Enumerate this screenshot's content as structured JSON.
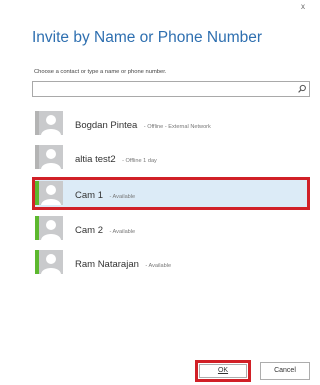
{
  "dialog": {
    "close_label": "x",
    "title": "Invite by Name or Phone Number",
    "instruction": "Choose a contact or type a name or phone number.",
    "search": {
      "value": "",
      "placeholder": "",
      "icon": "search-icon"
    },
    "contacts": [
      {
        "name": "Bogdan Pintea",
        "status": "- Offline - External Network",
        "presence": "offline",
        "selected": false
      },
      {
        "name": "altia test2",
        "status": "- Offline 1 day",
        "presence": "offline",
        "selected": false
      },
      {
        "name": "Cam 1",
        "status": "- Available",
        "presence": "available",
        "selected": true
      },
      {
        "name": "Cam 2",
        "status": "- Available",
        "presence": "available",
        "selected": false
      },
      {
        "name": "Ram Natarajan",
        "status": "- Available",
        "presence": "available",
        "selected": false
      }
    ],
    "buttons": {
      "ok_label": "OK",
      "cancel_label": "Cancel"
    }
  },
  "colors": {
    "title": "#2e6fb0",
    "presence_offline": "#b4b4b4",
    "presence_available": "#5cb82e",
    "selection_background": "#dcebf7",
    "highlight_border": "#d12027"
  }
}
